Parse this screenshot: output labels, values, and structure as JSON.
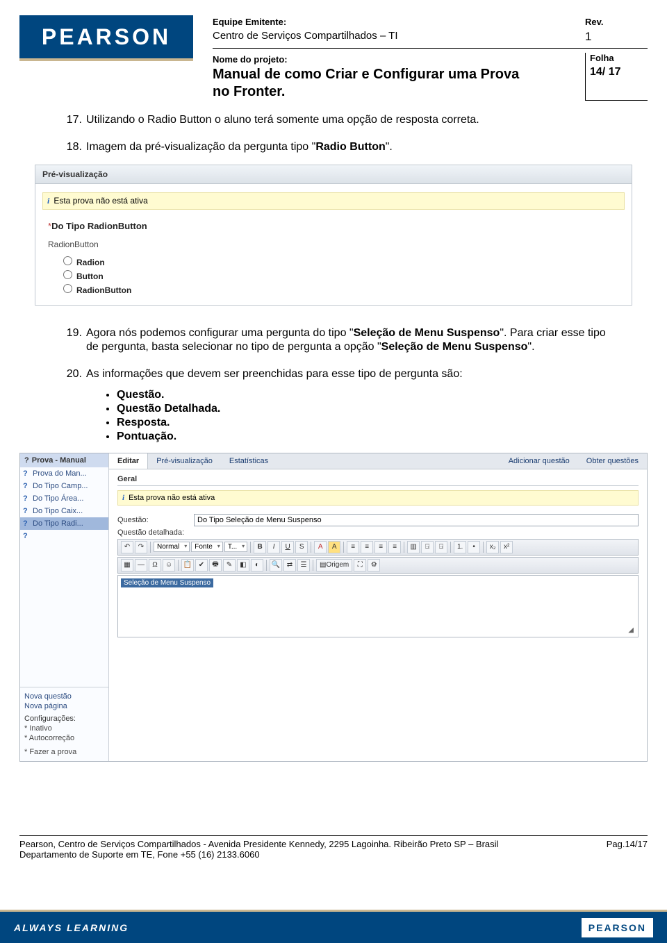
{
  "header": {
    "brand": "PEARSON",
    "equipe_lbl": "Equipe Emitente:",
    "rev_lbl": "Rev.",
    "centro": "Centro de Serviços Compartilhados – TI",
    "rev_val": "1",
    "nome_lbl": "Nome do projeto:",
    "folha_lbl": "Folha",
    "proj": "Manual de como Criar e Configurar uma Prova no Fronter.",
    "folha_val": "14/ 17"
  },
  "items": {
    "i17_num": "17.",
    "i17": "Utilizando o Radio Button o aluno terá somente uma opção de resposta correta.",
    "i18_num": "18.",
    "i18_a": "Imagem da pré-visualização da pergunta tipo \"",
    "i18_b": "Radio Button",
    "i18_c": "\".",
    "i19_num": "19.",
    "i19_a": "Agora nós podemos configurar uma pergunta do tipo \"",
    "i19_b": "Seleção de Menu Suspenso",
    "i19_c": "\". Para criar esse tipo de pergunta, basta selecionar no tipo de pergunta a opção \"",
    "i19_d": "Seleção de Menu Suspenso",
    "i19_e": "\".",
    "i20_num": "20.",
    "i20": "As informações que devem ser preenchidas para esse tipo de pergunta são:"
  },
  "bullets": [
    "Questão.",
    "Questão Detalhada.",
    "Resposta.",
    "Pontuação."
  ],
  "shot1": {
    "tab": "Pré-visualização",
    "notice": "Esta prova não está ativa",
    "qtitle": "Do Tipo RadionButton",
    "sub": "RadionButton",
    "opts": [
      "Radion",
      "Button",
      "RadionButton"
    ]
  },
  "shot2": {
    "top": "Prova - Manual",
    "side": [
      "Prova do Man...",
      "Do Tipo Camp...",
      "Do Tipo Área...",
      "Do Tipo Caix...",
      "Do Tipo Radi..."
    ],
    "side_bot": {
      "nova_q": "Nova questão",
      "nova_p": "Nova página",
      "cfg": "Configurações:",
      "inativo": "* Inativo",
      "auto": "* Autocorreção",
      "fazer": "* Fazer a prova"
    },
    "tabs": {
      "editar": "Editar",
      "previz": "Pré-visualização",
      "estat": "Estatísticas",
      "add": "Adicionar questão",
      "obter": "Obter questões"
    },
    "geral": "Geral",
    "notice": "Esta prova não está ativa",
    "q_lbl": "Questão:",
    "q_val": "Do Tipo Seleção de Menu Suspenso",
    "qd_lbl": "Questão detalhada:",
    "tb1": {
      "normal": "Normal",
      "fonte": "Fonte",
      "t": "T...",
      "origem": "Origem"
    },
    "chip": "Seleção de Menu Suspenso"
  },
  "footer": {
    "line1": "Pearson, Centro de Serviços Compartilhados - Avenida Presidente Kennedy, 2295 Lagoinha. Ribeirão Preto SP – Brasil",
    "pag": "Pag.14/17",
    "line2": "Departamento de Suporte em TE, Fone +55 (16) 2133.6060",
    "always": "ALWAYS LEARNING",
    "brand": "PEARSON"
  }
}
